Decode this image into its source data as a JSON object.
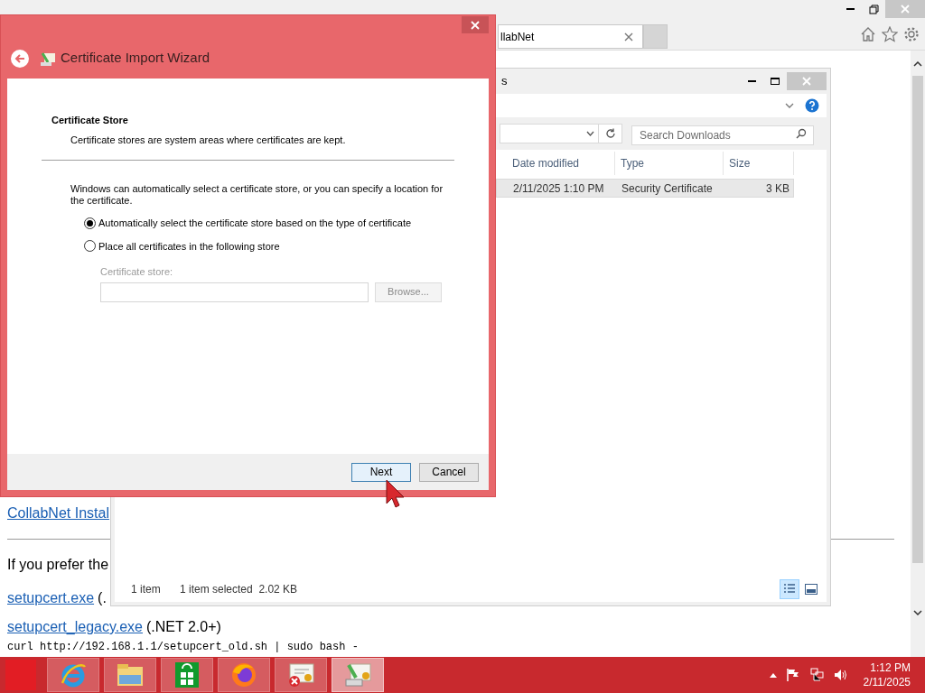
{
  "browser": {
    "tab": {
      "title": "llabNet"
    },
    "page": {
      "link": "CollabNet Instal",
      "paragraph": "If you prefer the",
      "downloads": [
        {
          "link": "setupcert.exe",
          "note": "(."
        },
        {
          "link": "setupcert_legacy.exe",
          "note": "(.NET 2.0+)"
        }
      ],
      "command": "curl http://192.168.1.1/setupcert_old.sh | sudo bash -"
    }
  },
  "explorer": {
    "title": "s",
    "search": {
      "placeholder": "Search Downloads"
    },
    "columns": [
      "Date modified",
      "Type",
      "Size"
    ],
    "rows": [
      {
        "date_modified": "2/11/2025 1:10 PM",
        "type": "Security Certificate",
        "size": "3 KB",
        "selected": true
      }
    ],
    "status": [
      "1 item",
      "1 item selected  2.02 KB"
    ],
    "views": [
      {
        "kind": "details",
        "selected": true
      },
      {
        "kind": "thumbnails",
        "selected": false
      }
    ]
  },
  "wizard": {
    "title": "Certificate Import Wizard",
    "heading": "Certificate Store",
    "subheading": "Certificate stores are system areas where certificates are kept.",
    "body": "Windows can automatically select a certificate store, or you can specify a location for the certificate.",
    "options": [
      {
        "label": "Automatically select the certificate store based on the type of certificate",
        "selected": true
      },
      {
        "label": "Place all certificates in the following store",
        "selected": false
      }
    ],
    "store_label": "Certificate store:",
    "browse": {
      "label": "Browse...",
      "disabled": true
    },
    "buttons": [
      {
        "label": "Next",
        "default": true
      },
      {
        "label": "Cancel",
        "default": false
      }
    ]
  },
  "taskbar": {
    "apps": [
      {
        "kind": "ie",
        "active": false
      },
      {
        "kind": "explorer",
        "active": false
      },
      {
        "kind": "store",
        "active": false
      },
      {
        "kind": "firefox",
        "active": false
      },
      {
        "kind": "certificate-error",
        "active": false
      },
      {
        "kind": "certificate-install",
        "active": true
      }
    ],
    "time": "1:12 PM",
    "date": "2/11/2025"
  }
}
